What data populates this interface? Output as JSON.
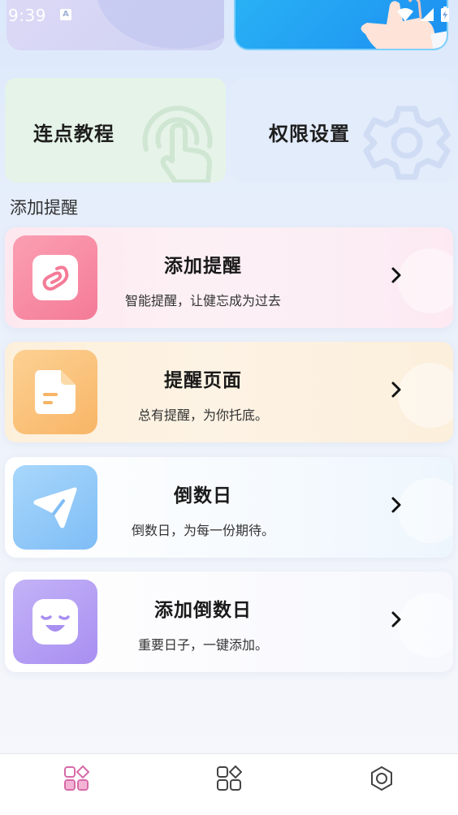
{
  "status_bar": {
    "time": "9:39",
    "indicator": "A",
    "icons": [
      "wifi-icon",
      "signal-icon",
      "battery-charging-icon"
    ]
  },
  "top_cards": {
    "left": {
      "icon": "decorative-blob"
    },
    "right": {
      "icon": "hand-pointer-icon"
    }
  },
  "quick_tiles": [
    {
      "label": "连点教程",
      "icon": "touch-finger-icon"
    },
    {
      "label": "权限设置",
      "icon": "gear-icon"
    }
  ],
  "section": {
    "title": "添加提醒"
  },
  "cards": [
    {
      "title": "添加提醒",
      "subtitle": "智能提醒，让健忘成为过去",
      "icon": "link-icon",
      "accent": "#f47b97"
    },
    {
      "title": "提醒页面",
      "subtitle": "总有提醒，为你托底。",
      "icon": "document-icon",
      "accent": "#f8b566"
    },
    {
      "title": "倒数日",
      "subtitle": "倒数日，为每一份期待。",
      "icon": "paper-plane-icon",
      "accent": "#7fbdf6"
    },
    {
      "title": "添加倒数日",
      "subtitle": "重要日子，一键添加。",
      "icon": "smiley-face-icon",
      "accent": "#a88ff1"
    }
  ],
  "bottom_nav": {
    "items": [
      {
        "name": "home",
        "icon": "grid-home-icon",
        "active": true,
        "color": "#d76aa8"
      },
      {
        "name": "apps",
        "icon": "grid-apps-icon",
        "active": false,
        "color": "#444444"
      },
      {
        "name": "settings",
        "icon": "hexagon-settings-icon",
        "active": false,
        "color": "#444444"
      }
    ]
  }
}
